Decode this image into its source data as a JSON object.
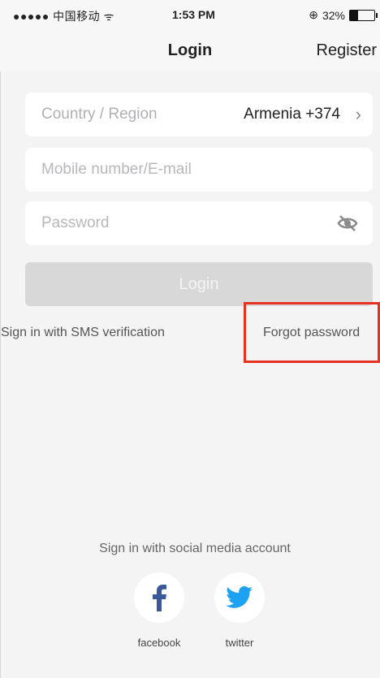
{
  "status_bar": {
    "carrier": "●●●●● 中国移动",
    "time": "1:53 PM",
    "battery_text": "32%"
  },
  "nav": {
    "title": "Login",
    "register": "Register"
  },
  "form": {
    "country_label": "Country / Region",
    "country_value": "Armenia +374",
    "mobile_placeholder": "Mobile number/E-mail",
    "password_placeholder": "Password"
  },
  "login_button": "Login",
  "links": {
    "sms": "Sign in with SMS verification",
    "forgot": "Forgot password"
  },
  "social": {
    "title": "Sign in with social media account",
    "items": [
      {
        "label": "facebook",
        "icon": "facebook-icon",
        "color": "#3b5998"
      },
      {
        "label": "twitter",
        "icon": "twitter-icon",
        "color": "#1da1f2"
      }
    ]
  },
  "accent": {
    "highlight_border": "#e5311f"
  }
}
